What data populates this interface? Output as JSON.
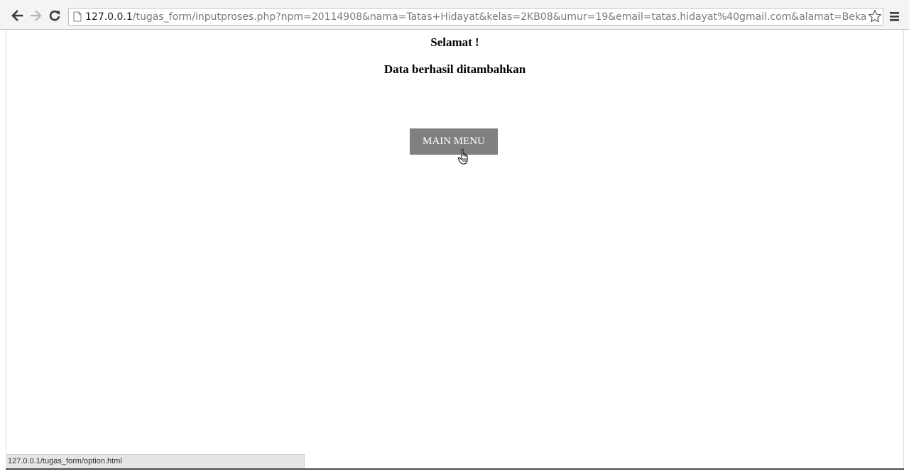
{
  "browser": {
    "url_host": "127.0.0.1",
    "url_rest": "/tugas_form/inputproses.php?npm=20114908&nama=Tatas+Hidayat&kelas=2KB08&umur=19&email=tatas.hidayat%40gmail.com&alamat=Bekasi+&kirim_dat",
    "icons": {
      "back": "back-arrow-icon",
      "forward": "forward-arrow-icon",
      "reload": "reload-icon",
      "page": "page-icon",
      "bookmark": "star-icon",
      "menu": "hamburger-menu-icon"
    },
    "status_url": "127.0.0.1/tugas_form/option.html"
  },
  "page": {
    "heading_1": "Selamat !",
    "heading_2": "Data berhasil ditambahkan",
    "button_label": "MAIN MENU",
    "button_color": "#808080"
  }
}
